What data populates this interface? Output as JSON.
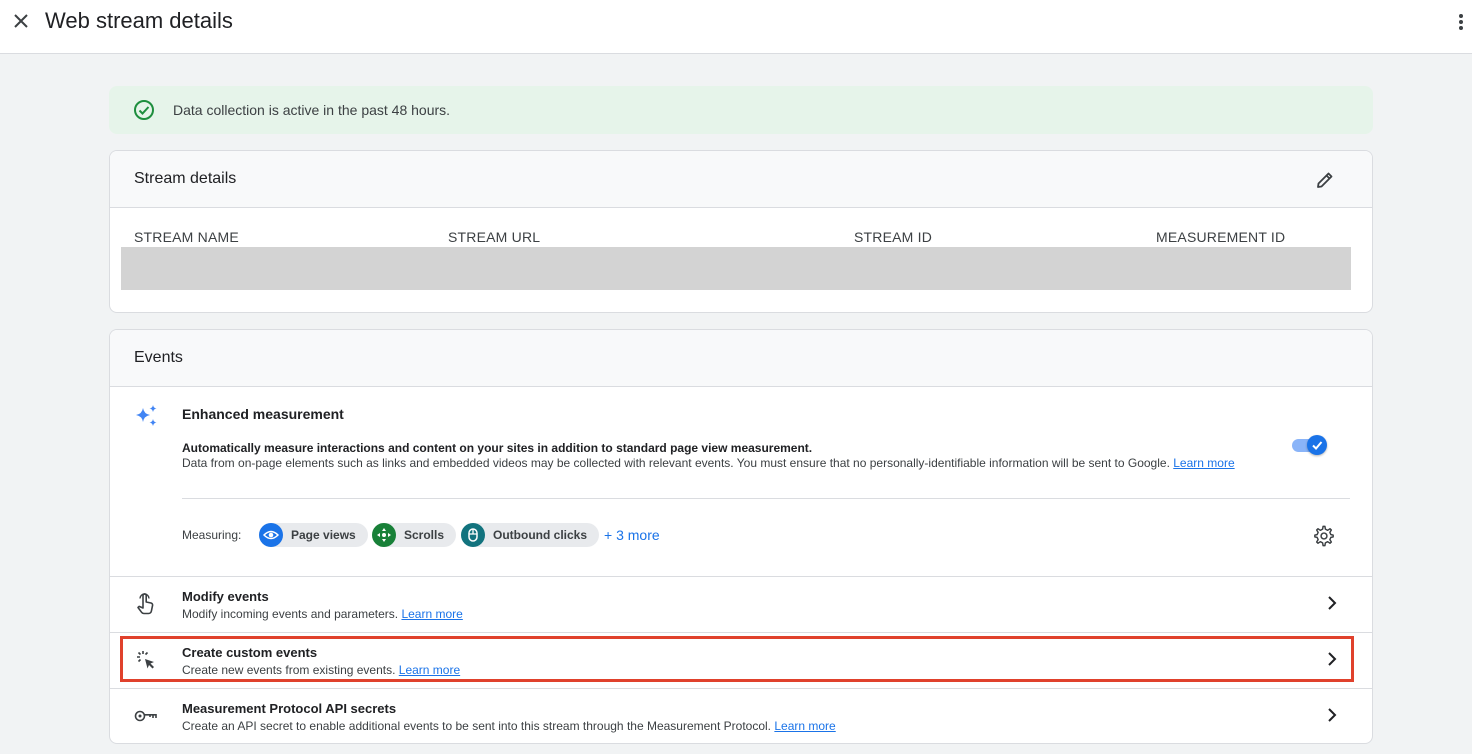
{
  "header": {
    "title": "Web stream details",
    "close_icon": "close-icon",
    "more_icon": "more-vert-icon"
  },
  "banner": {
    "text": "Data collection is active in the past 48 hours.",
    "icon": "check-circle-icon",
    "color": "#1e8e3e"
  },
  "stream_details": {
    "title": "Stream details",
    "edit_icon": "edit-icon",
    "columns": [
      "STREAM NAME",
      "STREAM URL",
      "STREAM ID",
      "MEASUREMENT ID"
    ]
  },
  "events": {
    "title": "Events",
    "enhanced": {
      "title": "Enhanced measurement",
      "desc_bold": "Automatically measure interactions and content on your sites in addition to standard page view measurement.",
      "desc": "Data from on-page elements such as links and embedded videos may be collected with relevant events. You must ensure that no personally-identifiable information will be sent to Google.",
      "learn_more": "Learn more",
      "toggle_on": true,
      "measuring_label": "Measuring:",
      "chips": [
        "Page views",
        "Scrolls",
        "Outbound clicks"
      ],
      "more": "+ 3 more"
    },
    "rows": [
      {
        "title": "Modify events",
        "desc": "Modify incoming events and parameters.",
        "learn_more": "Learn more"
      },
      {
        "title": "Create custom events",
        "desc": "Create new events from existing events.",
        "learn_more": "Learn more"
      },
      {
        "title": "Measurement Protocol API secrets",
        "desc": "Create an API secret to enable additional events to be sent into this stream through the Measurement Protocol.",
        "learn_more": "Learn more"
      }
    ]
  },
  "colors": {
    "accent": "#1a73e8",
    "highlight": "#e0412c",
    "chip_page_views": "#1a73e8",
    "chip_scrolls": "#188038",
    "chip_outbound": "#12737e"
  }
}
